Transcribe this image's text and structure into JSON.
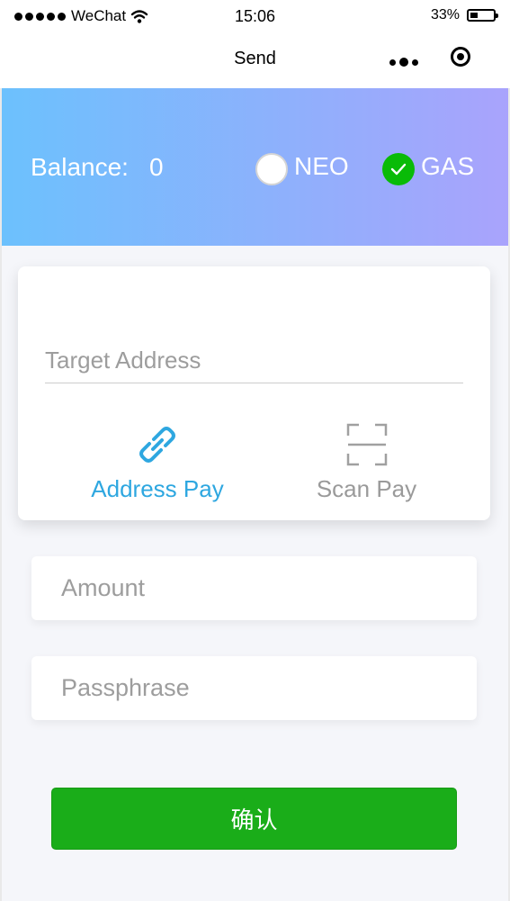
{
  "status_bar": {
    "carrier": "WeChat",
    "time": "15:06",
    "battery": "33%",
    "battery_level": 0.33
  },
  "nav": {
    "title": "Send"
  },
  "balance": {
    "label": "Balance:",
    "value": "0",
    "assets": [
      {
        "name": "NEO",
        "selected": false
      },
      {
        "name": "GAS",
        "selected": true
      }
    ]
  },
  "pay_card": {
    "target_placeholder": "Target Address",
    "target_value": "",
    "address_pay_label": "Address Pay",
    "scan_pay_label": "Scan Pay",
    "active_mode": "Address Pay"
  },
  "form": {
    "amount_placeholder": "Amount",
    "passphrase_placeholder": "Passphrase"
  },
  "confirm": {
    "label": "确认"
  },
  "colors": {
    "gradient_start": "#6cc1fd",
    "gradient_end": "#a9a3fc",
    "accent_blue": "#2ea7e0",
    "confirm_green": "#1aad19",
    "selected_green": "#09bb07"
  }
}
